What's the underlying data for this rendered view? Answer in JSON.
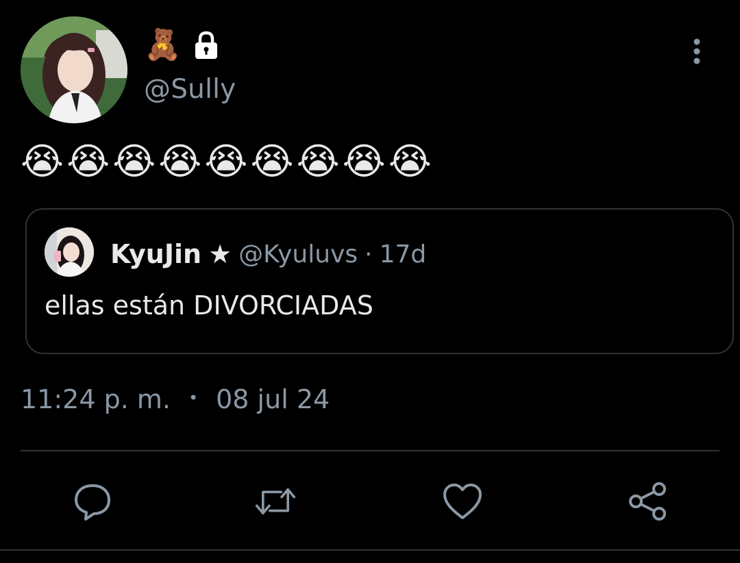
{
  "author": {
    "display_emoji": "🧸",
    "protected_icon": "lock-icon",
    "handle": "@Sully",
    "avatar_icon": "user-avatar"
  },
  "menu": {
    "more_icon": "more-vertical-icon"
  },
  "tweet": {
    "text": "😭😭😭😭😭😭😭😭😭"
  },
  "quote": {
    "name": "KyuJin",
    "name_symbol": "★",
    "handle": "@Kyuluvs",
    "separator": "·",
    "time_ago": "17d",
    "text": "ellas están DIVORCIADAS",
    "avatar_icon": "user-avatar"
  },
  "meta": {
    "time": "11:24 p. m.",
    "separator": "•",
    "date": "08 jul 24"
  },
  "actions": [
    {
      "name": "reply",
      "icon": "reply-icon"
    },
    {
      "name": "retweet",
      "icon": "retweet-icon"
    },
    {
      "name": "like",
      "icon": "heart-icon"
    },
    {
      "name": "share",
      "icon": "share-icon"
    }
  ],
  "colors": {
    "background": "#000000",
    "primary_text": "#e7e9ea",
    "secondary_text": "#8b98a5",
    "border": "#2f3336",
    "icon": "#8b98a5"
  }
}
